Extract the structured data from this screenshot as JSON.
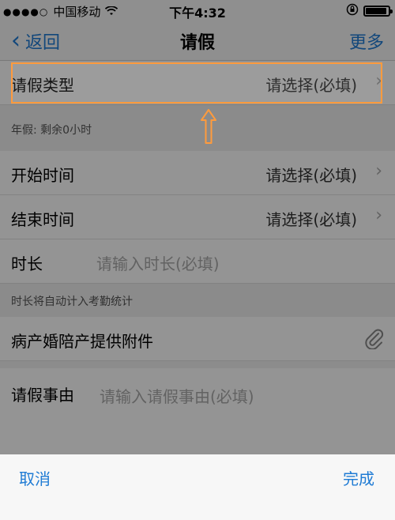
{
  "status_bar": {
    "carrier": "中国移动",
    "time": "下午4:32",
    "battery_level": 0.92
  },
  "nav": {
    "back_label": "返回",
    "title": "请假",
    "more_label": "更多"
  },
  "form": {
    "leave_type": {
      "label": "请假类型",
      "value": "请选择(必填)"
    },
    "annual_leave_note": "年假: 剩余0小时",
    "start_time": {
      "label": "开始时间",
      "value": "请选择(必填)"
    },
    "end_time": {
      "label": "结束时间",
      "value": "请选择(必填)"
    },
    "duration": {
      "label": "时长",
      "placeholder": "请输入时长(必填)"
    },
    "duration_note": "时长将自动计入考勤统计",
    "attachment": {
      "label": "病产婚陪产提供附件"
    },
    "reason": {
      "label": "请假事由",
      "placeholder": "请输入请假事由(必填)"
    }
  },
  "picker": {
    "cancel_label": "取消",
    "done_label": "完成"
  },
  "colors": {
    "accent": "#1f7bd4",
    "highlight": "#ff9b3d"
  }
}
